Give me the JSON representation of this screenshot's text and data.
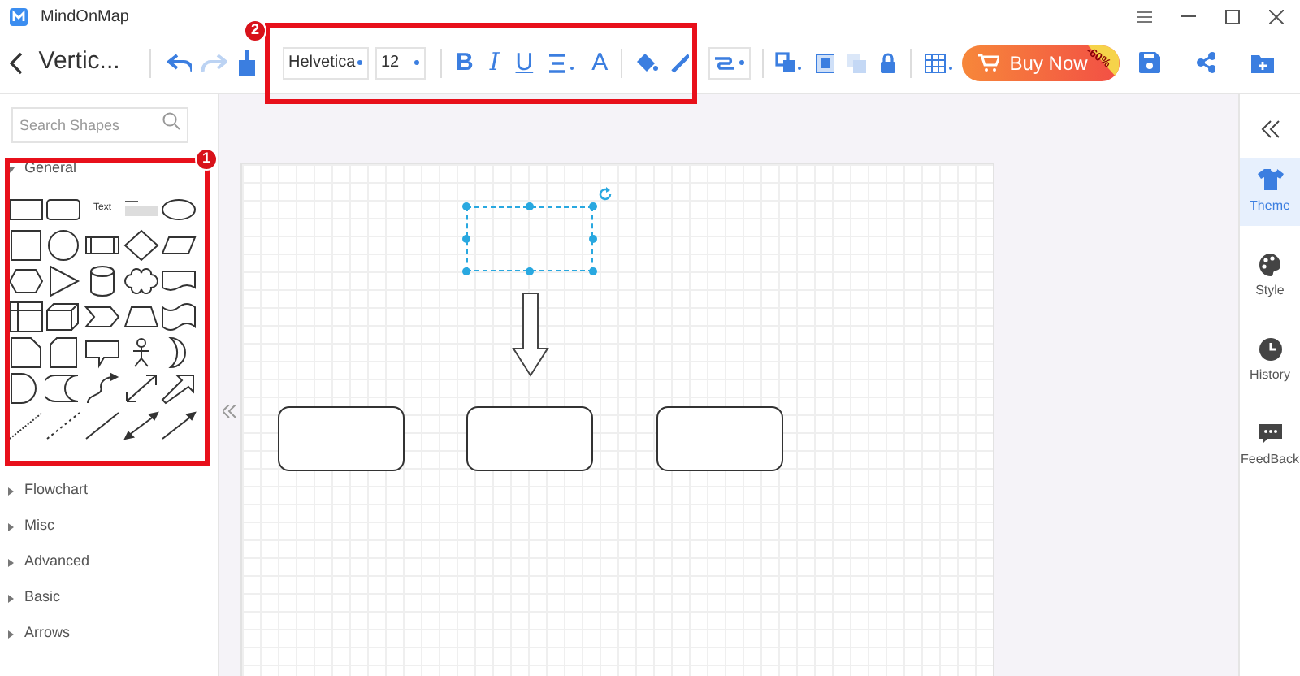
{
  "app": {
    "title": "MindOnMap"
  },
  "toolbar": {
    "document_title": "Vertic...",
    "font": "Helvetica",
    "font_size": "12",
    "format_letters": [
      "B",
      "I",
      "U",
      "A"
    ],
    "buy_button": "Buy Now",
    "discount": "-60%"
  },
  "sidebar": {
    "search_placeholder": "Search Shapes",
    "text_shape": "Text",
    "sections": [
      {
        "label": "General",
        "expanded": true
      },
      {
        "label": "Flowchart",
        "expanded": false
      },
      {
        "label": "Misc",
        "expanded": false
      },
      {
        "label": "Advanced",
        "expanded": false
      },
      {
        "label": "Basic",
        "expanded": false
      },
      {
        "label": "Arrows",
        "expanded": false
      }
    ]
  },
  "annotations": [
    "2",
    "1"
  ],
  "right_panel": {
    "items": [
      {
        "label": "Theme",
        "selected": true
      },
      {
        "label": "Style",
        "selected": false
      },
      {
        "label": "History",
        "selected": false
      },
      {
        "label": "FeedBack",
        "selected": false
      }
    ]
  }
}
